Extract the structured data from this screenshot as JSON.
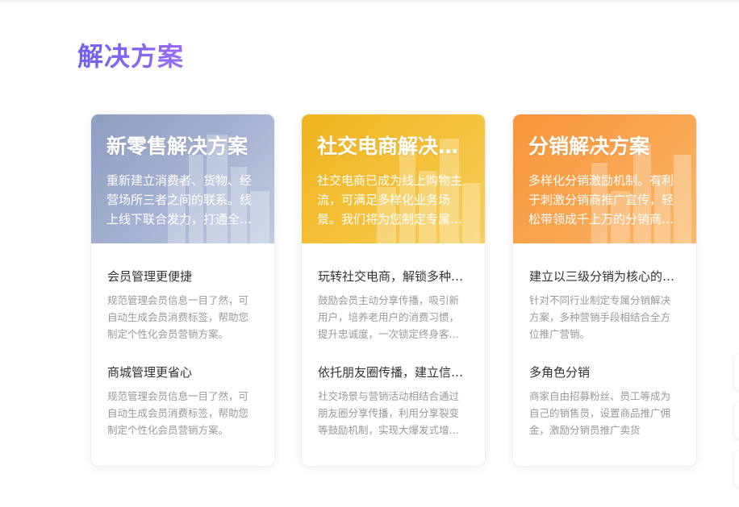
{
  "section": {
    "title": "解决方案"
  },
  "colors": {
    "title_gradient_start": "#6f5ff0",
    "title_gradient_end": "#9a6cf2",
    "card1_header": "#9aa7c9",
    "card2_header": "#f2b82a",
    "card3_header": "#f89d45"
  },
  "cards": [
    {
      "title": "新零售解决方案",
      "desc": "重新建立消费者、货物、经营场所三者之间的联系。线上线下联合发力，打通全渠道营销闭环。",
      "features": [
        {
          "title": "会员管理更便捷",
          "desc": "规范管理会员信息一目了然，可自动生成会员消费标签，帮助您制定个性化会员营销方案。"
        },
        {
          "title": "商城管理更省心",
          "desc": "规范管理会员信息一目了然，可自动生成会员消费标签，帮助您制定个性化会员营销方案。"
        }
      ]
    },
    {
      "title": "社交电商解决方案",
      "desc": "社交电商已成为线上购物主流，可满足多样化业务场景。我们将为您制定专属社交电商解决方案。",
      "features": [
        {
          "title": "玩转社交电商，解锁多种玩法",
          "desc": "鼓励会员主动分享传播，吸引新用户，培养老用户的消费习惯，提升忠诚度，一次锁定终身客户。"
        },
        {
          "title": "依托朋友圈传播，建立信任关系",
          "desc": "社交场景与营销活动相结合通过朋友圈分享传播，利用分享裂变等鼓励机制，实现大爆发式增长。"
        }
      ]
    },
    {
      "title": "分销解决方案",
      "desc": "多样化分销激励机制。有利于刺激分销商推广宣传，轻松带领成千上万的分销商共同发展。",
      "features": [
        {
          "title": "建立以三级分销为核心的体系",
          "desc": "针对不同行业制定专属分销解决方案，多种营销手段相结合全方位推广营销。"
        },
        {
          "title": "多角色分销",
          "desc": "商家自由招募粉丝、员工等成为自己的销售员，设置商品推广佣金，激励分销员推广卖货"
        }
      ]
    }
  ]
}
